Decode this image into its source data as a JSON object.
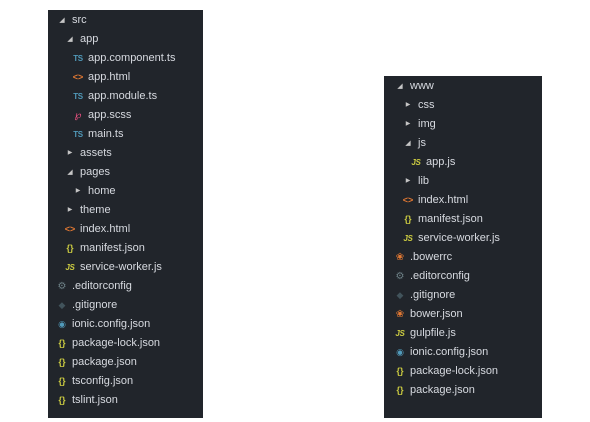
{
  "left_tree": [
    {
      "label": "src",
      "icon": "arrow-down-icon",
      "depth": 0
    },
    {
      "label": "app",
      "icon": "arrow-down-icon",
      "depth": 1
    },
    {
      "label": "app.component.ts",
      "icon": "ts-icon",
      "depth": 2
    },
    {
      "label": "app.html",
      "icon": "html-icon",
      "depth": 2
    },
    {
      "label": "app.module.ts",
      "icon": "ts-icon",
      "depth": 2
    },
    {
      "label": "app.scss",
      "icon": "scss-icon",
      "depth": 2
    },
    {
      "label": "main.ts",
      "icon": "ts-icon",
      "depth": 2
    },
    {
      "label": "assets",
      "icon": "arrow-right-icon",
      "depth": 1
    },
    {
      "label": "pages",
      "icon": "arrow-down-icon",
      "depth": 1
    },
    {
      "label": "home",
      "icon": "arrow-right-icon",
      "depth": 2
    },
    {
      "label": "theme",
      "icon": "arrow-right-icon",
      "depth": 1
    },
    {
      "label": "index.html",
      "icon": "html-icon",
      "depth": 1
    },
    {
      "label": "manifest.json",
      "icon": "json-icon",
      "depth": 1
    },
    {
      "label": "service-worker.js",
      "icon": "js-icon",
      "depth": 1
    },
    {
      "label": ".editorconfig",
      "icon": "gear-icon",
      "depth": 0
    },
    {
      "label": ".gitignore",
      "icon": "gitignore-icon",
      "depth": 0
    },
    {
      "label": "ionic.config.json",
      "icon": "ionic-icon",
      "depth": 0
    },
    {
      "label": "package-lock.json",
      "icon": "json-icon",
      "depth": 0
    },
    {
      "label": "package.json",
      "icon": "json-icon",
      "depth": 0
    },
    {
      "label": "tsconfig.json",
      "icon": "json-icon",
      "depth": 0
    },
    {
      "label": "tslint.json",
      "icon": "json-icon",
      "depth": 0
    }
  ],
  "right_tree": [
    {
      "label": "www",
      "icon": "arrow-down-icon",
      "depth": 0
    },
    {
      "label": "css",
      "icon": "arrow-right-icon",
      "depth": 1
    },
    {
      "label": "img",
      "icon": "arrow-right-icon",
      "depth": 1
    },
    {
      "label": "js",
      "icon": "arrow-down-icon",
      "depth": 1
    },
    {
      "label": "app.js",
      "icon": "js-icon",
      "depth": 2
    },
    {
      "label": "lib",
      "icon": "arrow-right-icon",
      "depth": 1
    },
    {
      "label": "index.html",
      "icon": "html-icon",
      "depth": 1
    },
    {
      "label": "manifest.json",
      "icon": "json-icon",
      "depth": 1
    },
    {
      "label": "service-worker.js",
      "icon": "js-icon",
      "depth": 1
    },
    {
      "label": ".bowerrc",
      "icon": "bower-icon",
      "depth": 0
    },
    {
      "label": ".editorconfig",
      "icon": "gear-icon",
      "depth": 0
    },
    {
      "label": ".gitignore",
      "icon": "gitignore-icon",
      "depth": 0
    },
    {
      "label": "bower.json",
      "icon": "bower-icon",
      "depth": 0
    },
    {
      "label": "gulpfile.js",
      "icon": "js-icon",
      "depth": 0
    },
    {
      "label": "ionic.config.json",
      "icon": "ionic-icon",
      "depth": 0
    },
    {
      "label": "package-lock.json",
      "icon": "json-icon",
      "depth": 0
    },
    {
      "label": "package.json",
      "icon": "json-icon",
      "depth": 0
    }
  ],
  "colors": {
    "panel_bg": "#21252b",
    "text": "#d7dae0",
    "ts": "#519aba",
    "js": "#cbcb41",
    "html": "#e37933",
    "json": "#cbcb41",
    "scss": "#f55385",
    "gear": "#6d8086",
    "bower": "#e37933"
  }
}
